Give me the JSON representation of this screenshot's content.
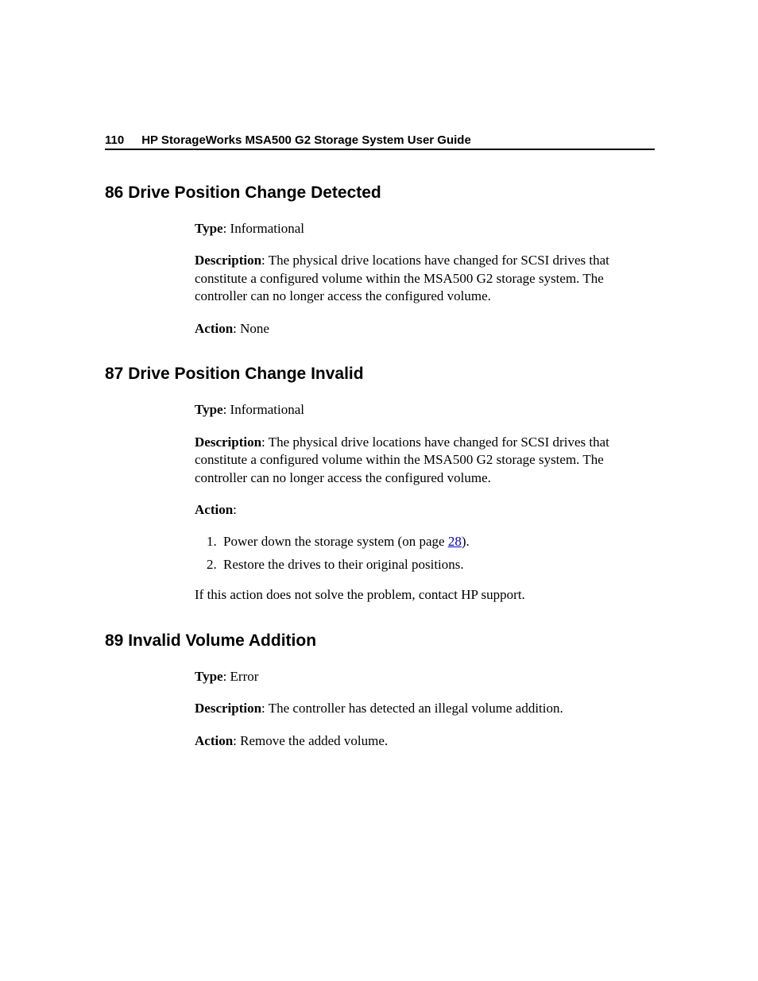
{
  "header": {
    "page_number": "110",
    "doc_title": "HP StorageWorks MSA500 G2 Storage System User Guide"
  },
  "labels": {
    "type": "Type",
    "description": "Description",
    "action": "Action"
  },
  "sections": [
    {
      "heading": "86 Drive Position Change Detected",
      "type_value": ": Informational",
      "description_value": ": The physical drive locations have changed for SCSI drives that constitute a configured volume within the MSA500 G2 storage system. The controller can no longer access the configured volume.",
      "action_value": ": None"
    },
    {
      "heading": "87 Drive Position Change Invalid",
      "type_value": ": Informational",
      "description_value": ": The physical drive locations have changed for SCSI drives that constitute a configured volume within the MSA500 G2 storage system. The controller can no longer access the configured volume.",
      "action_value": ":",
      "step1_pre": "Power down the storage system (on page ",
      "step1_link": "28",
      "step1_post": ").",
      "step2": "Restore the drives to their original positions.",
      "afternote": "If this action does not solve the problem, contact HP support."
    },
    {
      "heading": "89 Invalid Volume Addition",
      "type_value": ": Error",
      "description_value": ": The controller has detected an illegal volume addition.",
      "action_value": ": Remove the added volume."
    }
  ]
}
